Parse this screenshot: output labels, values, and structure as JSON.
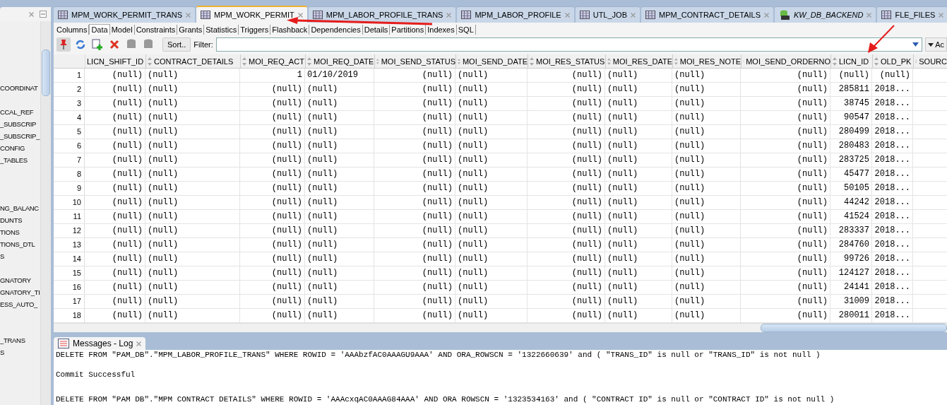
{
  "sidebar": {
    "items": [
      "COORDINAT",
      "CCAL_REF",
      "_SUBSCRIP",
      "_SUBSCRIP_",
      "CONFIG",
      "_TABLES",
      "NG_BALANC",
      "DUNTS",
      "TIONS",
      "TIONS_DTL",
      "S",
      "GNATORY",
      "GNATORY_TI",
      "ESS_AUTO_",
      "_TRANS",
      "S"
    ]
  },
  "tabs": [
    {
      "label": "MPM_WORK_PERMIT_TRANS",
      "kind": "table",
      "selected": false
    },
    {
      "label": "MPM_WORK_PERMIT",
      "kind": "table",
      "selected": true
    },
    {
      "label": "MPM_LABOR_PROFILE_TRANS",
      "kind": "table",
      "selected": false
    },
    {
      "label": "MPM_LABOR_PROFILE",
      "kind": "table",
      "selected": false
    },
    {
      "label": "UTL_JOB",
      "kind": "table",
      "selected": false
    },
    {
      "label": "MPM_CONTRACT_DETAILS",
      "kind": "table",
      "selected": false
    },
    {
      "label": "KW_DB_BACKEND",
      "kind": "sql",
      "selected": false
    },
    {
      "label": "FLE_FILES",
      "kind": "table",
      "selected": false
    }
  ],
  "subtabs": [
    {
      "label": "Columns",
      "selected": false
    },
    {
      "label": "Data",
      "selected": true
    },
    {
      "label": "Model",
      "selected": false
    },
    {
      "label": "Constraints",
      "selected": false
    },
    {
      "label": "Grants",
      "selected": false
    },
    {
      "label": "Statistics",
      "selected": false
    },
    {
      "label": "Triggers",
      "selected": false
    },
    {
      "label": "Flashback",
      "selected": false
    },
    {
      "label": "Dependencies",
      "selected": false
    },
    {
      "label": "Details",
      "selected": false
    },
    {
      "label": "Partitions",
      "selected": false
    },
    {
      "label": "Indexes",
      "selected": false
    },
    {
      "label": "SQL",
      "selected": false
    }
  ],
  "toolbar": {
    "sort_button": "Sort..",
    "filter_label": "Filter:",
    "actions_button": "Ac"
  },
  "table": {
    "columns": [
      "LICN_SHIFT_ID",
      "CONTRACT_DETAILS",
      "MOI_REQ_ACT",
      "MOI_REQ_DATE",
      "MOI_SEND_STATUS",
      "MOI_SEND_DATE",
      "MOI_RES_STATUS",
      "MOI_RES_DATE",
      "MOI_RES_NOTE",
      "MOI_SEND_ORDERNO",
      "LICN_ID",
      "OLD_PK",
      "SOURC"
    ],
    "rows": [
      {
        "number": "1",
        "cells": [
          "(null)",
          "(null)",
          "1",
          "01/10/2019",
          "(null)",
          "(null)",
          "(null)",
          "(null)",
          "(null)",
          "(null)",
          "(null)",
          "(null)"
        ]
      },
      {
        "number": "2",
        "cells": [
          "(null)",
          "(null)",
          "(null)",
          "(null)",
          "(null)",
          "(null)",
          "(null)",
          "(null)",
          "(null)",
          "(null)",
          "285811",
          "2018..."
        ]
      },
      {
        "number": "3",
        "cells": [
          "(null)",
          "(null)",
          "(null)",
          "(null)",
          "(null)",
          "(null)",
          "(null)",
          "(null)",
          "(null)",
          "(null)",
          "38745",
          "2018..."
        ]
      },
      {
        "number": "4",
        "cells": [
          "(null)",
          "(null)",
          "(null)",
          "(null)",
          "(null)",
          "(null)",
          "(null)",
          "(null)",
          "(null)",
          "(null)",
          "90547",
          "2018..."
        ]
      },
      {
        "number": "5",
        "cells": [
          "(null)",
          "(null)",
          "(null)",
          "(null)",
          "(null)",
          "(null)",
          "(null)",
          "(null)",
          "(null)",
          "(null)",
          "280499",
          "2018..."
        ]
      },
      {
        "number": "6",
        "cells": [
          "(null)",
          "(null)",
          "(null)",
          "(null)",
          "(null)",
          "(null)",
          "(null)",
          "(null)",
          "(null)",
          "(null)",
          "280483",
          "2018..."
        ]
      },
      {
        "number": "7",
        "cells": [
          "(null)",
          "(null)",
          "(null)",
          "(null)",
          "(null)",
          "(null)",
          "(null)",
          "(null)",
          "(null)",
          "(null)",
          "283725",
          "2018..."
        ]
      },
      {
        "number": "8",
        "cells": [
          "(null)",
          "(null)",
          "(null)",
          "(null)",
          "(null)",
          "(null)",
          "(null)",
          "(null)",
          "(null)",
          "(null)",
          "45477",
          "2018..."
        ]
      },
      {
        "number": "9",
        "cells": [
          "(null)",
          "(null)",
          "(null)",
          "(null)",
          "(null)",
          "(null)",
          "(null)",
          "(null)",
          "(null)",
          "(null)",
          "50105",
          "2018..."
        ]
      },
      {
        "number": "10",
        "cells": [
          "(null)",
          "(null)",
          "(null)",
          "(null)",
          "(null)",
          "(null)",
          "(null)",
          "(null)",
          "(null)",
          "(null)",
          "44242",
          "2018..."
        ]
      },
      {
        "number": "11",
        "cells": [
          "(null)",
          "(null)",
          "(null)",
          "(null)",
          "(null)",
          "(null)",
          "(null)",
          "(null)",
          "(null)",
          "(null)",
          "41524",
          "2018..."
        ]
      },
      {
        "number": "12",
        "cells": [
          "(null)",
          "(null)",
          "(null)",
          "(null)",
          "(null)",
          "(null)",
          "(null)",
          "(null)",
          "(null)",
          "(null)",
          "283337",
          "2018..."
        ]
      },
      {
        "number": "13",
        "cells": [
          "(null)",
          "(null)",
          "(null)",
          "(null)",
          "(null)",
          "(null)",
          "(null)",
          "(null)",
          "(null)",
          "(null)",
          "284760",
          "2018..."
        ]
      },
      {
        "number": "14",
        "cells": [
          "(null)",
          "(null)",
          "(null)",
          "(null)",
          "(null)",
          "(null)",
          "(null)",
          "(null)",
          "(null)",
          "(null)",
          "99726",
          "2018..."
        ]
      },
      {
        "number": "15",
        "cells": [
          "(null)",
          "(null)",
          "(null)",
          "(null)",
          "(null)",
          "(null)",
          "(null)",
          "(null)",
          "(null)",
          "(null)",
          "124127",
          "2018..."
        ]
      },
      {
        "number": "16",
        "cells": [
          "(null)",
          "(null)",
          "(null)",
          "(null)",
          "(null)",
          "(null)",
          "(null)",
          "(null)",
          "(null)",
          "(null)",
          "24141",
          "2018..."
        ]
      },
      {
        "number": "17",
        "cells": [
          "(null)",
          "(null)",
          "(null)",
          "(null)",
          "(null)",
          "(null)",
          "(null)",
          "(null)",
          "(null)",
          "(null)",
          "31009",
          "2018..."
        ]
      },
      {
        "number": "18",
        "cells": [
          "(null)",
          "(null)",
          "(null)",
          "(null)",
          "(null)",
          "(null)",
          "(null)",
          "(null)",
          "(null)",
          "(null)",
          "280011",
          "2018..."
        ]
      }
    ]
  },
  "log": {
    "title": "Messages - Log",
    "lines": [
      "DELETE FROM \"PAM_DB\".\"MPM_LABOR_PROFILE_TRANS\" WHERE ROWID = 'AAAbzfAC0AAAGU9AAA' AND ORA_ROWSCN = '1322660639' and ( \"TRANS_ID\" is null or \"TRANS_ID\" is not null )",
      "Commit Successful",
      "DELETE FROM \"PAM DB\".\"MPM CONTRACT DETAILS\" WHERE ROWID = 'AAAcxqAC0AAAG84AAA' AND ORA ROWSCN = '1323534163' and ( \"CONTRACT ID\" is null or \"CONTRACT ID\" is not null )"
    ]
  }
}
